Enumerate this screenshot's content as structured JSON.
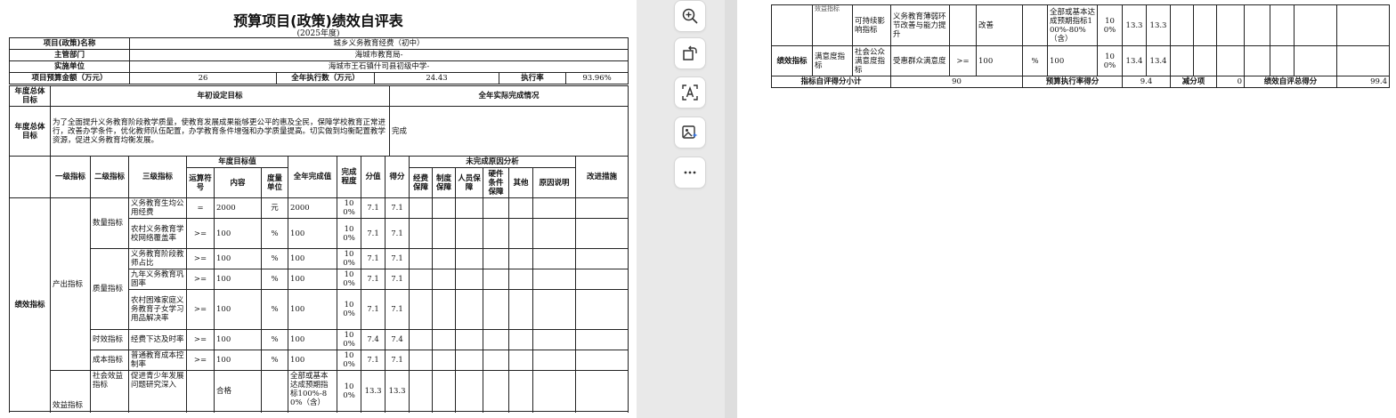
{
  "title": "预算项目(政策)绩效自评表",
  "year": "(2025年度)",
  "info": {
    "project_name_label": "项目(政策)名称",
    "project_name": "城乡义务教育经费（初中）",
    "dept_label": "主管部门",
    "dept": "海城市教育局-",
    "unit_label": "实施单位",
    "unit": "海城市王石镇什司县初级中学-",
    "budget_label": "项目预算金额（万元）",
    "budget": "26",
    "exec_label": "全年执行数（万元）",
    "exec": "24.43",
    "rate_label": "执行率",
    "rate": "93.96%"
  },
  "goal": {
    "label": "年度总体目标",
    "initial_label": "年初设定目标",
    "actual_label": "全年实际完成情况",
    "initial_text": "为了全面提升义务教育阶段教学质量，使教育发展成果能够更公平的惠及全民，保障学校教育正常进行，改善办学条件，优化教师队伍配置，办学教育条件增强和办学质量提高。切实做到均衡配置教学资源，促进义务教育均衡发展。",
    "actual_text": "完成"
  },
  "headers": {
    "perf": "绩效指标",
    "l1": "一级指标",
    "l2": "二级指标",
    "l3": "三级指标",
    "target": "年度目标值",
    "op": "运算符号",
    "content": "内容",
    "unit": "度量单位",
    "done": "全年完成值",
    "degree": "完成程度",
    "score": "分值",
    "got": "得分",
    "reason_group": "未完成原因分析",
    "r1": "经费保障",
    "r2": "制度保障",
    "r3": "人员保障",
    "r4": "硬件条件保障",
    "r5": "其他",
    "r6": "原因说明",
    "fix": "改进措施"
  },
  "groups": {
    "output": "产出指标",
    "benefit": "效益指标",
    "qty": "数量指标",
    "qual": "质量指标",
    "time": "时效指标",
    "cost": "成本指标",
    "social": "社会效益指标"
  },
  "rows": [
    {
      "name": "义务教育生均公用经费",
      "op": "=",
      "content": "2000",
      "unit": "元",
      "done": "2000",
      "degree": "100%",
      "score": "7.1",
      "got": "7.1"
    },
    {
      "name": "农村义务教育学校网络覆盖率",
      "op": ">=",
      "content": "100",
      "unit": "%",
      "done": "100",
      "degree": "100%",
      "score": "7.1",
      "got": "7.1"
    },
    {
      "name": "义务教育阶段教师占比",
      "op": ">=",
      "content": "100",
      "unit": "%",
      "done": "100",
      "degree": "100%",
      "score": "7.1",
      "got": "7.1"
    },
    {
      "name": "九年义务教育巩固率",
      "op": ">=",
      "content": "100",
      "unit": "%",
      "done": "100",
      "degree": "100%",
      "score": "7.1",
      "got": "7.1"
    },
    {
      "name": "农村困难家庭义务教育子女学习用品解决率",
      "op": ">=",
      "content": "100",
      "unit": "%",
      "done": "100",
      "degree": "100%",
      "score": "7.1",
      "got": "7.1"
    },
    {
      "name": "经费下达及时率",
      "op": ">=",
      "content": "100",
      "unit": "%",
      "done": "100",
      "degree": "100%",
      "score": "7.4",
      "got": "7.4"
    },
    {
      "name": "普通教育成本控制率",
      "op": ">=",
      "content": "100",
      "unit": "%",
      "done": "100",
      "degree": "100%",
      "score": "7.1",
      "got": "7.1"
    },
    {
      "name": "促进青少年发展问题研究深入",
      "op": "",
      "content": "合格",
      "unit": "",
      "done": "全部或基本达成预期指标100%-80%（含）",
      "degree": "100%",
      "score": "13.3",
      "got": "13.3"
    }
  ],
  "right": {
    "top_cut": "效益指标",
    "sustain_l2": "可持续影响指标",
    "sustain_name": "义务教育薄弱环节改善与能力提升",
    "sustain_content": "改善",
    "sustain_done": "全部或基本达成预期指标100%-80%（含）",
    "sustain_degree": "100%",
    "sustain_score": "13.3",
    "sustain_got": "13.3",
    "sat_l1": "绩效指标",
    "sat_l2": "满意度指标",
    "sat_l3a": "社会公众满意度指标",
    "sat_name": "受惠群众满意度",
    "sat_op": ">=",
    "sat_content": "100",
    "sat_unit": "%",
    "sat_done": "100",
    "sat_degree": "100%",
    "sat_score": "13.4",
    "sat_got": "13.4",
    "sum_label": "指标自评得分小计",
    "sum_value": "90",
    "budget_score_label": "预算执行率得分",
    "budget_score": "9.4",
    "deduct_label": "减分项",
    "deduct": "0",
    "total_label": "绩效自评总得分",
    "total": "99.4"
  },
  "toolbar": {
    "icons": [
      "zoom-in-icon",
      "rotate-icon",
      "text-recognize-icon",
      "image-ai-icon",
      "more-icon"
    ]
  }
}
